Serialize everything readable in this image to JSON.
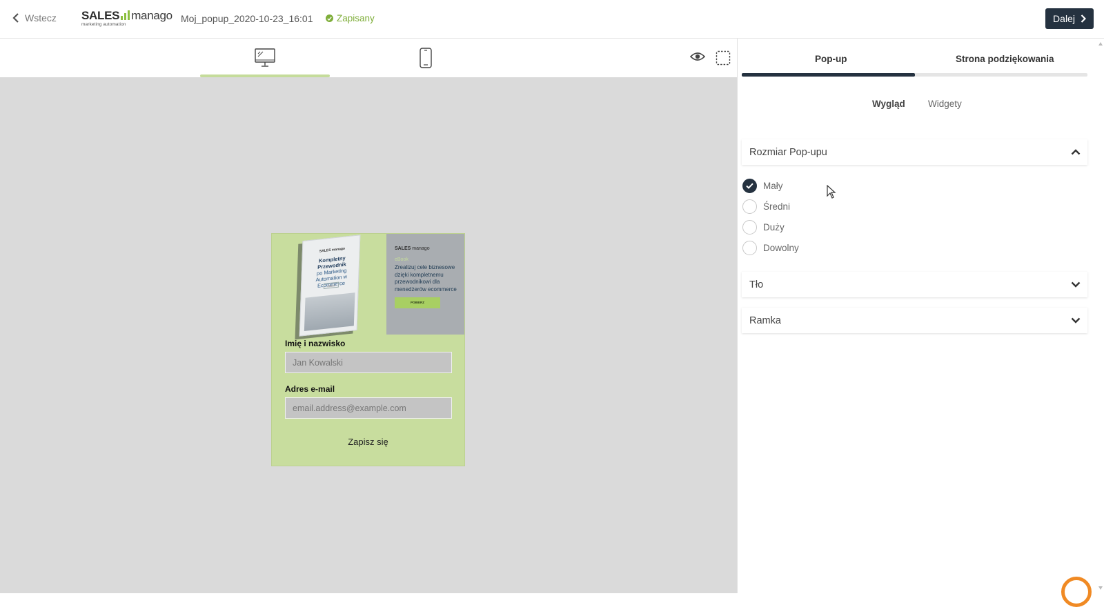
{
  "header": {
    "back_label": "Wstecz",
    "logo_word_left": "SALES",
    "logo_word_right": "manago",
    "logo_subtitle": "marketing automation",
    "document_title": "Moj_popup_2020-10-23_16:01",
    "status": "Zapisany",
    "next_label": "Dalej"
  },
  "toolbar": {
    "devices": [
      "desktop-icon",
      "mobile-icon"
    ],
    "active_device": "desktop"
  },
  "popup": {
    "banner": {
      "book_brand": "SALES manago",
      "book_title_bold": "Kompletny Przewodnik",
      "book_title_rest": "po Marketing Automation w Ecommerce",
      "book_tag": "eBook",
      "brand_left": "SALES",
      "brand_right": "manago",
      "tag": "eBook",
      "text": "Zrealizuj cele biznesowe dzięki kompletnemu przewodnikowi dla menedżerów ecommerce",
      "button": "POBIERZ"
    },
    "name_label": "Imię i nazwisko",
    "name_placeholder": "Jan Kowalski",
    "email_label": "Adres e-mail",
    "email_placeholder": "email.address@example.com",
    "submit_label": "Zapisz się"
  },
  "panel": {
    "tabs": [
      {
        "label": "Pop-up",
        "active": true
      },
      {
        "label": "Strona podziękowania",
        "active": false
      }
    ],
    "subtabs": [
      {
        "label": "Wygląd",
        "active": true
      },
      {
        "label": "Widgety",
        "active": false
      }
    ],
    "size_section": {
      "title": "Rozmiar Pop-upu",
      "expanded": true,
      "options": [
        {
          "label": "Mały",
          "checked": true
        },
        {
          "label": "Średni",
          "checked": false
        },
        {
          "label": "Duży",
          "checked": false
        },
        {
          "label": "Dowolny",
          "checked": false
        }
      ]
    },
    "background_section": {
      "title": "Tło",
      "expanded": false
    },
    "frame_section": {
      "title": "Ramka",
      "expanded": false
    }
  },
  "colors": {
    "accent_dark": "#253240",
    "saved_green": "#7fae3a",
    "popup_green": "#c8dd9e",
    "canvas_grey": "#dadada"
  }
}
